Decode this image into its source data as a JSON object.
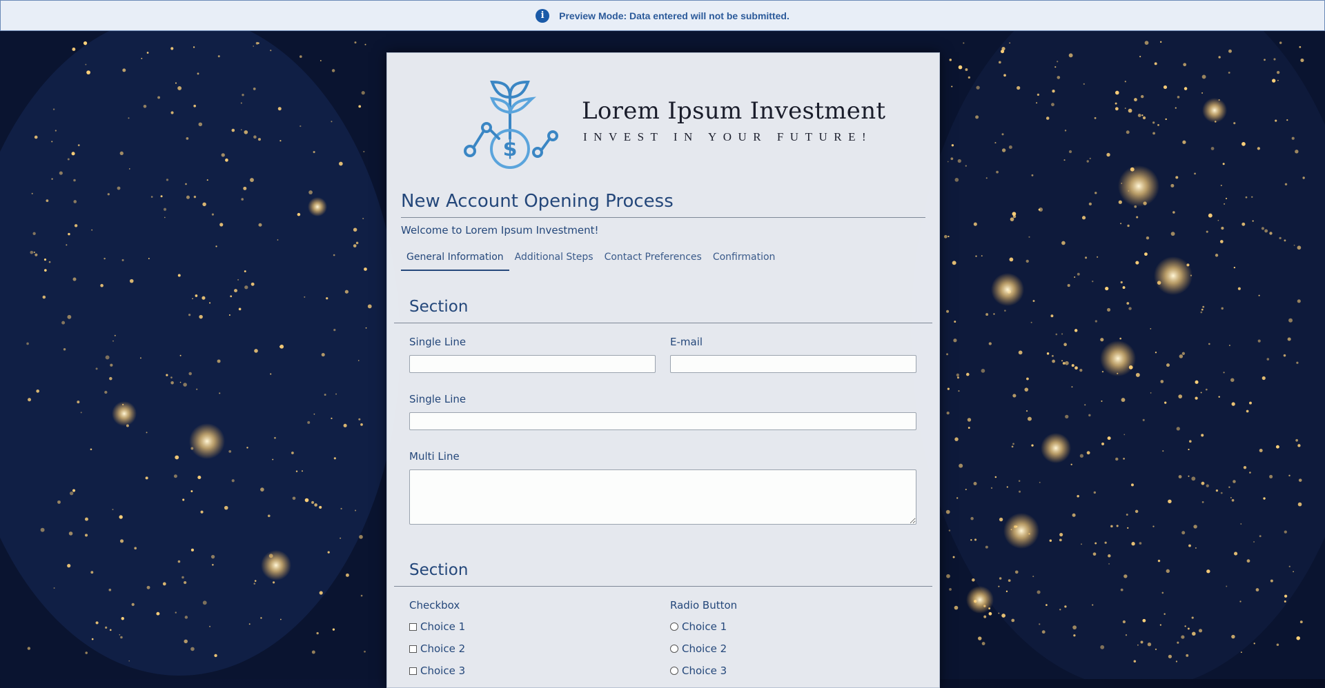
{
  "banner": {
    "icon": "info-icon",
    "message": "Preview Mode: Data entered will not be submitted."
  },
  "brand": {
    "name": "Lorem Ipsum Investment",
    "tagline": "INVEST IN YOUR FUTURE!",
    "logo_icon": "plant-dollar-logo-icon",
    "logo_symbol": "$",
    "logo_color": "#3a86c4"
  },
  "form": {
    "title": "New Account Opening Process",
    "welcome": "Welcome to Lorem Ipsum Investment!",
    "tabs": [
      {
        "label": "General Information",
        "active": true
      },
      {
        "label": "Additional Steps",
        "active": false
      },
      {
        "label": "Contact Preferences",
        "active": false
      },
      {
        "label": "Confirmation",
        "active": false
      }
    ],
    "sections": [
      {
        "title": "Section",
        "fields": {
          "single_line_1": {
            "label": "Single Line",
            "value": ""
          },
          "email": {
            "label": "E-mail",
            "value": ""
          },
          "single_line_2": {
            "label": "Single Line",
            "value": ""
          },
          "multi_line": {
            "label": "Multi Line",
            "value": ""
          }
        }
      },
      {
        "title": "Section",
        "checkbox": {
          "label": "Checkbox",
          "choices": [
            "Choice 1",
            "Choice 2",
            "Choice 3"
          ]
        },
        "radio": {
          "label": "Radio Button",
          "choices": [
            "Choice 1",
            "Choice 2",
            "Choice 3"
          ]
        }
      }
    ]
  },
  "colors": {
    "accent": "#24477a",
    "banner_bg": "#e8eef7",
    "banner_text": "#2b5a9a",
    "background": "#0b1533",
    "city_lights": "#ffd27a"
  }
}
